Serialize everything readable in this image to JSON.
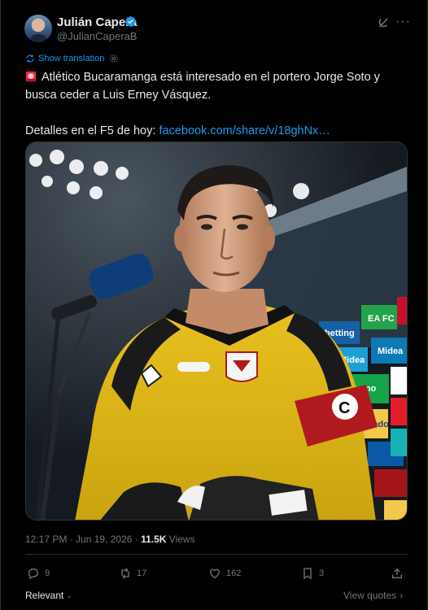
{
  "author": {
    "name": "Julián Capera",
    "handle": "@JulianCaperaB"
  },
  "translation": {
    "label": "Show translation"
  },
  "tweet": {
    "line1": "Atlético Bucaramanga está interesado en el portero Jorge Soto y",
    "line2": "busca ceder a Luis Erney Vásquez.",
    "line3_prefix": "Detalles en el F5 de hoy: ",
    "link": "facebook.com/share/v/18ghNx…"
  },
  "meta": {
    "time": "12:17 PM · Jun 19, 2026 · ",
    "views_count": "11.5K",
    "views_label": " Views"
  },
  "actions": {
    "replies": "9",
    "reposts": "17",
    "likes": "162",
    "bookmarks": "3"
  },
  "footer": {
    "sort": "Relevant",
    "view_quotes": "View quotes"
  },
  "colors": {
    "accent": "#1d9bf0",
    "muted": "#71767b",
    "text": "#e7e9ea",
    "background": "#000000"
  },
  "icons": [
    "verified-badge-icon",
    "grok-icon",
    "more-icon",
    "translate-icon",
    "gear-icon",
    "police-light-icon",
    "reply-icon",
    "repost-icon",
    "like-icon",
    "bookmark-icon",
    "share-icon",
    "chevron-down-icon",
    "chevron-right-icon"
  ]
}
